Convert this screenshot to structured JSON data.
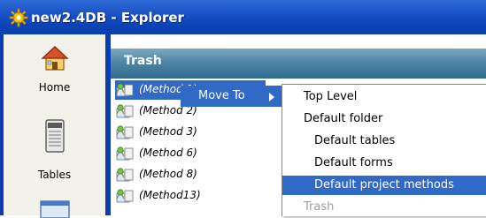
{
  "window": {
    "title": "new2.4DB - Explorer"
  },
  "sidebar": {
    "items": [
      {
        "label": "Home",
        "icon": "home-icon"
      },
      {
        "label": "Tables",
        "icon": "tables-icon"
      },
      {
        "label": "",
        "icon": "forms-icon"
      }
    ]
  },
  "panel": {
    "title": "Trash"
  },
  "methods": [
    {
      "label": "(Method 1)",
      "selected": true
    },
    {
      "label": "(Method 2)",
      "selected": false
    },
    {
      "label": "(Method 3)",
      "selected": false
    },
    {
      "label": "(Method 6)",
      "selected": false
    },
    {
      "label": "(Method 8)",
      "selected": false
    },
    {
      "label": "(Method13)",
      "selected": false
    }
  ],
  "context_menu": {
    "label": "Move To"
  },
  "submenu": {
    "items": [
      {
        "label": "Top Level",
        "indent": false,
        "selected": false,
        "disabled": false
      },
      {
        "label": "Default folder",
        "indent": false,
        "selected": false,
        "disabled": false
      },
      {
        "label": "Default tables",
        "indent": true,
        "selected": false,
        "disabled": false
      },
      {
        "label": "Default forms",
        "indent": true,
        "selected": false,
        "disabled": false
      },
      {
        "label": "Default project methods",
        "indent": true,
        "selected": true,
        "disabled": false
      },
      {
        "label": "Trash",
        "indent": false,
        "selected": false,
        "disabled": true
      }
    ]
  },
  "colors": {
    "selection": "#3169c6",
    "titlebar": "#1c55c8"
  }
}
